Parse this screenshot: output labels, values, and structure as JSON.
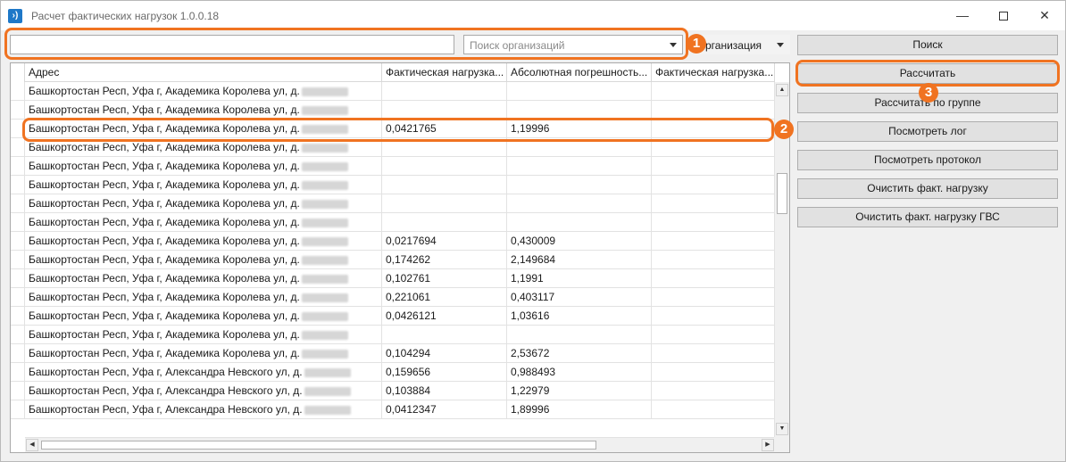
{
  "window": {
    "title": "Расчет фактических нагрузок 1.0.0.18",
    "app_icon": "›)",
    "minimize_glyph": "—",
    "close_glyph": "✕"
  },
  "toolbar": {
    "text_input_value": "",
    "org_search_placeholder": "Поиск организаций",
    "mode_select_value": "рганизация"
  },
  "buttons": [
    {
      "label": "Поиск"
    },
    {
      "label": "Рассчитать"
    },
    {
      "label": "Рассчитать по группе"
    },
    {
      "label": "Посмотреть лог"
    },
    {
      "label": "Посмотреть протокол"
    },
    {
      "label": "Очистить факт. нагрузку"
    },
    {
      "label": "Очистить факт. нагрузку ГВС"
    }
  ],
  "grid": {
    "columns": [
      "Адрес",
      "Фактическая нагрузка...",
      "Абсолютная погрешность...",
      "Фактическая нагрузка..."
    ],
    "rows": [
      {
        "address": "Башкортостан Респ, Уфа г, Академика Королева ул, д.",
        "v1": "",
        "v2": "",
        "v3": ""
      },
      {
        "address": "Башкортостан Респ, Уфа г, Академика Королева ул, д.",
        "v1": "",
        "v2": "",
        "v3": ""
      },
      {
        "address": "Башкортостан Респ, Уфа г, Академика Королева ул, д.",
        "v1": "0,0421765",
        "v2": "1,19996",
        "v3": ""
      },
      {
        "address": "Башкортостан Респ, Уфа г, Академика Королева ул, д.",
        "v1": "",
        "v2": "",
        "v3": ""
      },
      {
        "address": "Башкортостан Респ, Уфа г, Академика Королева ул, д.",
        "v1": "",
        "v2": "",
        "v3": ""
      },
      {
        "address": "Башкортостан Респ, Уфа г, Академика Королева ул, д.",
        "v1": "",
        "v2": "",
        "v3": ""
      },
      {
        "address": "Башкортостан Респ, Уфа г, Академика Королева ул, д.",
        "v1": "",
        "v2": "",
        "v3": ""
      },
      {
        "address": "Башкортостан Респ, Уфа г, Академика Королева ул, д.",
        "v1": "",
        "v2": "",
        "v3": ""
      },
      {
        "address": "Башкортостан Респ, Уфа г, Академика Королева ул, д.",
        "v1": "0,0217694",
        "v2": "0,430009",
        "v3": ""
      },
      {
        "address": "Башкортостан Респ, Уфа г, Академика Королева ул, д.",
        "v1": "0,174262",
        "v2": "2,149684",
        "v3": ""
      },
      {
        "address": "Башкортостан Респ, Уфа г, Академика Королева ул, д.",
        "v1": "0,102761",
        "v2": "1,1991",
        "v3": ""
      },
      {
        "address": "Башкортостан Респ, Уфа г, Академика Королева ул, д.",
        "v1": "0,221061",
        "v2": "0,403117",
        "v3": ""
      },
      {
        "address": "Башкортостан Респ, Уфа г, Академика Королева ул, д.",
        "v1": "0,0426121",
        "v2": "1,03616",
        "v3": ""
      },
      {
        "address": "Башкортостан Респ, Уфа г, Академика Королева ул, д.",
        "v1": "",
        "v2": "",
        "v3": ""
      },
      {
        "address": "Башкортостан Респ, Уфа г, Академика Королева ул, д.",
        "v1": "0,104294",
        "v2": "2,53672",
        "v3": ""
      },
      {
        "address": "Башкортостан Респ, Уфа г, Александра Невского ул, д.",
        "v1": "0,159656",
        "v2": "0,988493",
        "v3": ""
      },
      {
        "address": "Башкортостан Респ, Уфа г, Александра Невского ул, д.",
        "v1": "0,103884",
        "v2": "1,22979",
        "v3": ""
      },
      {
        "address": "Башкортостан Респ, Уфа г, Александра Невского ул, д.",
        "v1": "0,0412347",
        "v2": "1,89996",
        "v3": ""
      }
    ]
  },
  "scroll_glyphs": {
    "up": "▲",
    "down": "▼",
    "left": "◀",
    "right": "▶"
  },
  "callouts": [
    "1",
    "2",
    "3"
  ],
  "colors": {
    "accent": "#f07321",
    "app_icon": "#1e78c8"
  }
}
